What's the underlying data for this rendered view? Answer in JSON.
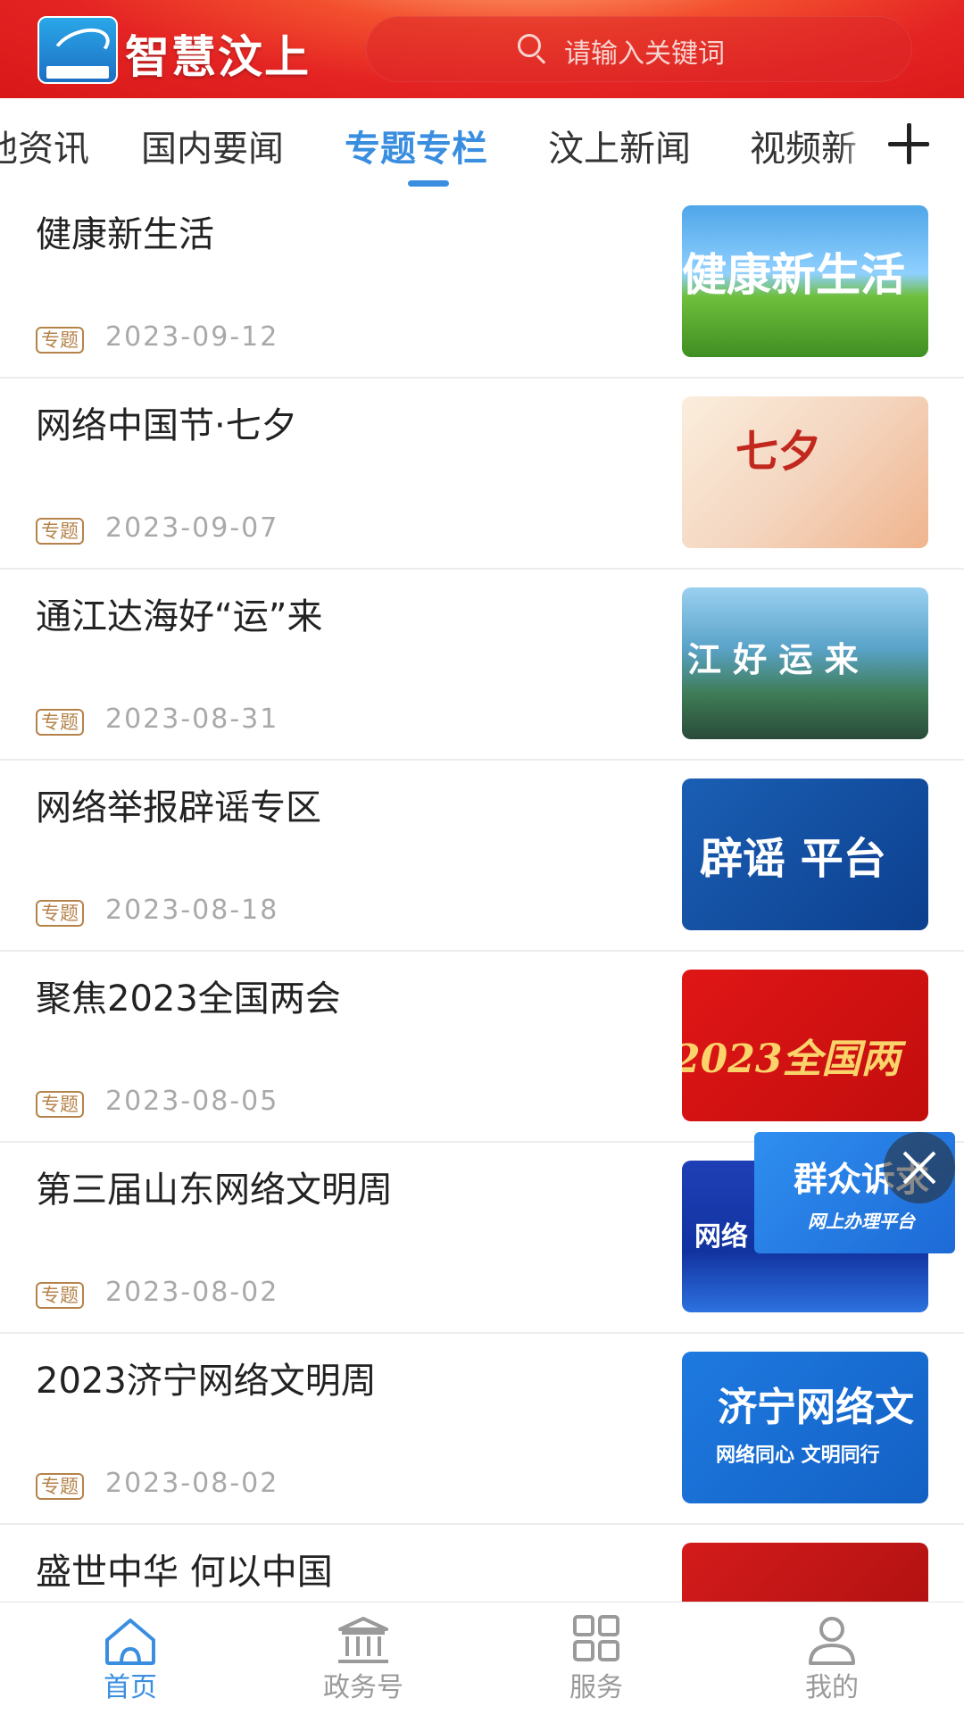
{
  "header": {
    "app_title": "智慧汶上",
    "search_placeholder": "请输入关键词"
  },
  "tabs": [
    {
      "label": "他资讯"
    },
    {
      "label": "国内要闻"
    },
    {
      "label": "专题专栏",
      "active": true
    },
    {
      "label": "汶上新闻"
    },
    {
      "label": "视频新"
    }
  ],
  "list": [
    {
      "title": "健康新生活",
      "tag": "专题",
      "date": "2023-09-12",
      "thumb_text": "健康新生活"
    },
    {
      "title": "网络中国节·七夕",
      "tag": "专题",
      "date": "2023-09-07",
      "thumb_text": "七夕"
    },
    {
      "title": "通江达海好“运”来",
      "tag": "专题",
      "date": "2023-08-31",
      "thumb_text": "江 好 运 来"
    },
    {
      "title": "网络举报辟谣专区",
      "tag": "专题",
      "date": "2023-08-18",
      "thumb_text": "辟谣 平台"
    },
    {
      "title": "聚焦2023全国两会",
      "tag": "专题",
      "date": "2023-08-05",
      "thumb_text": "2023全国两"
    },
    {
      "title": "第三届山东网络文明周",
      "tag": "专题",
      "date": "2023-08-02",
      "thumb_text": "网络"
    },
    {
      "title": "2023济宁网络文明周",
      "tag": "专题",
      "date": "2023-08-02",
      "thumb_text": "济宁网络文",
      "thumb_sub": "网络同心  文明同行"
    },
    {
      "title": "盛世中华  何以中国",
      "tag": "",
      "date": "",
      "thumb_text": ""
    }
  ],
  "float_ad": {
    "title": "群众诉求",
    "subtitle": "网上办理平台"
  },
  "bottom_nav": [
    {
      "label": "首页",
      "icon": "home-icon",
      "active": true
    },
    {
      "label": "政务号",
      "icon": "government-building-icon"
    },
    {
      "label": "服务",
      "icon": "grid-apps-icon"
    },
    {
      "label": "我的",
      "icon": "user-icon"
    }
  ],
  "colors": {
    "accent": "#3a8ee0",
    "header_red": "#e42323",
    "tag": "#b5834a"
  }
}
